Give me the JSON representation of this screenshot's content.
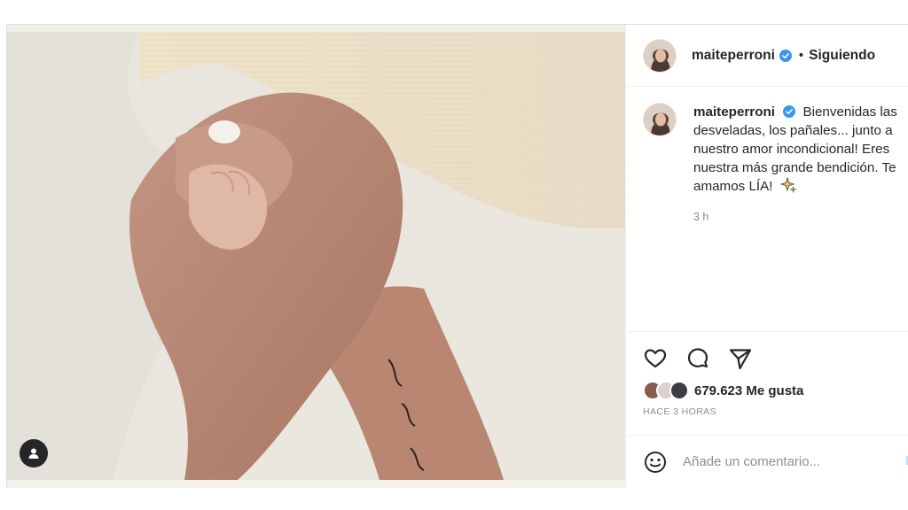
{
  "header": {
    "username": "maiteperroni",
    "separator": "•",
    "follow_status": "Siguiendo"
  },
  "caption": {
    "username": "maiteperroni",
    "text": "Bienvenidas las desveladas, los pañales... junto a nuestro amor incondicional! Eres nuestra más grande bendición. Te amamos LÍA!",
    "time": "3 h"
  },
  "likes": {
    "count_text": "679.623 Me gusta",
    "posted": "HACE 3 HORAS"
  },
  "comment": {
    "placeholder": "Añade un comentario...",
    "post_label": "P"
  },
  "icons": {
    "verified": "verified-badge-icon",
    "like": "heart-icon",
    "comment": "comment-bubble-icon",
    "share": "paper-plane-icon",
    "emoji": "smiley-icon",
    "tag": "user-tag-icon",
    "caption_emoji": "sparkles-icon"
  },
  "colors": {
    "verified": "#3897f0",
    "secondary_text": "#8e8e8e",
    "post_button": "#b2dffc"
  }
}
